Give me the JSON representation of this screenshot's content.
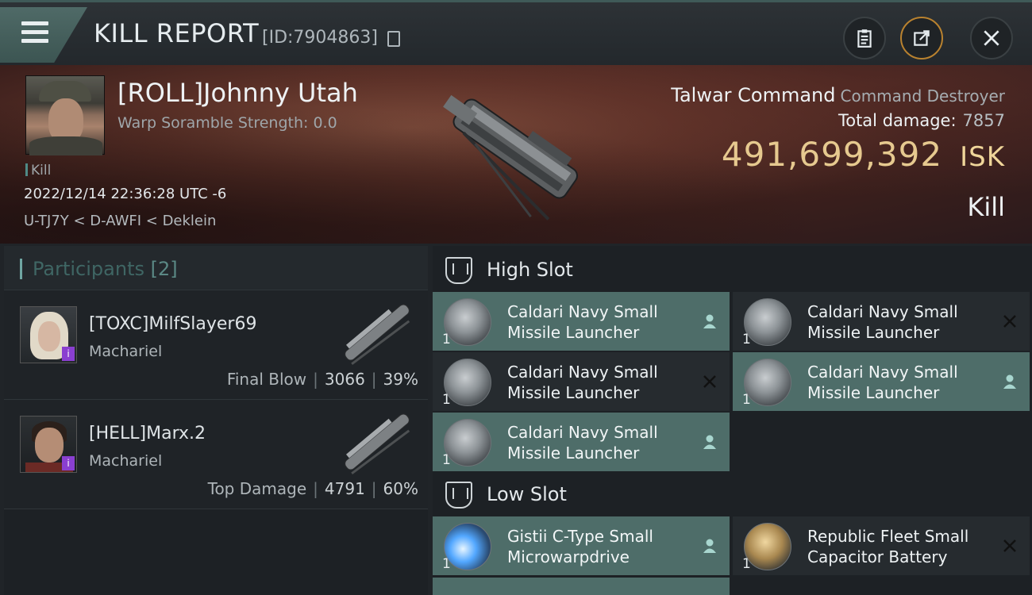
{
  "header": {
    "title": "KILL REPORT",
    "report_id": "[ID:7904863]"
  },
  "victim": {
    "name": "[ROLL]Johnny Utah",
    "warp_scramble": "Warp Soramble Strength: 0.0",
    "tag": "Kill",
    "datetime": "2022/12/14 22:36:28 UTC -6",
    "location": "U-TJ7Y < D-AWFI < Deklein",
    "ship_name": "Talwar Command",
    "ship_class": "Command Destroyer",
    "total_damage_label": "Total damage:",
    "total_damage": "7857",
    "isk_value": "491,699,392",
    "isk_unit": "ISK",
    "result": "Kill"
  },
  "participants": {
    "label": "Participants",
    "count": "[2]",
    "items": [
      {
        "name": "[TOXC]MilfSlayer69",
        "ship": "Machariel",
        "role": "Final Blow",
        "damage": "3066",
        "percent": "39%"
      },
      {
        "name": "[HELL]Marx.2",
        "ship": "Machariel",
        "role": "Top Damage",
        "damage": "4791",
        "percent": "60%"
      }
    ]
  },
  "fitting": {
    "high_slot_title": "High Slot",
    "low_slot_title": "Low Slot",
    "high": [
      {
        "line1": "Caldari Navy Small",
        "line2": "Missile Launcher",
        "qty": "1",
        "status": "dropped"
      },
      {
        "line1": "Caldari Navy Small",
        "line2": "Missile Launcher",
        "qty": "1",
        "status": "destroyed"
      },
      {
        "line1": "Caldari Navy Small",
        "line2": "Missile Launcher",
        "qty": "1",
        "status": "destroyed"
      },
      {
        "line1": "Caldari Navy Small",
        "line2": "Missile Launcher",
        "qty": "1",
        "status": "dropped"
      },
      {
        "line1": "Caldari Navy Small",
        "line2": "Missile Launcher",
        "qty": "1",
        "status": "dropped"
      }
    ],
    "low": [
      {
        "line1": "Gistii C-Type Small",
        "line2": "Microwarpdrive",
        "qty": "1",
        "status": "dropped"
      },
      {
        "line1": "Republic Fleet Small",
        "line2": "Capacitor Battery",
        "qty": "1",
        "status": "destroyed"
      }
    ]
  }
}
